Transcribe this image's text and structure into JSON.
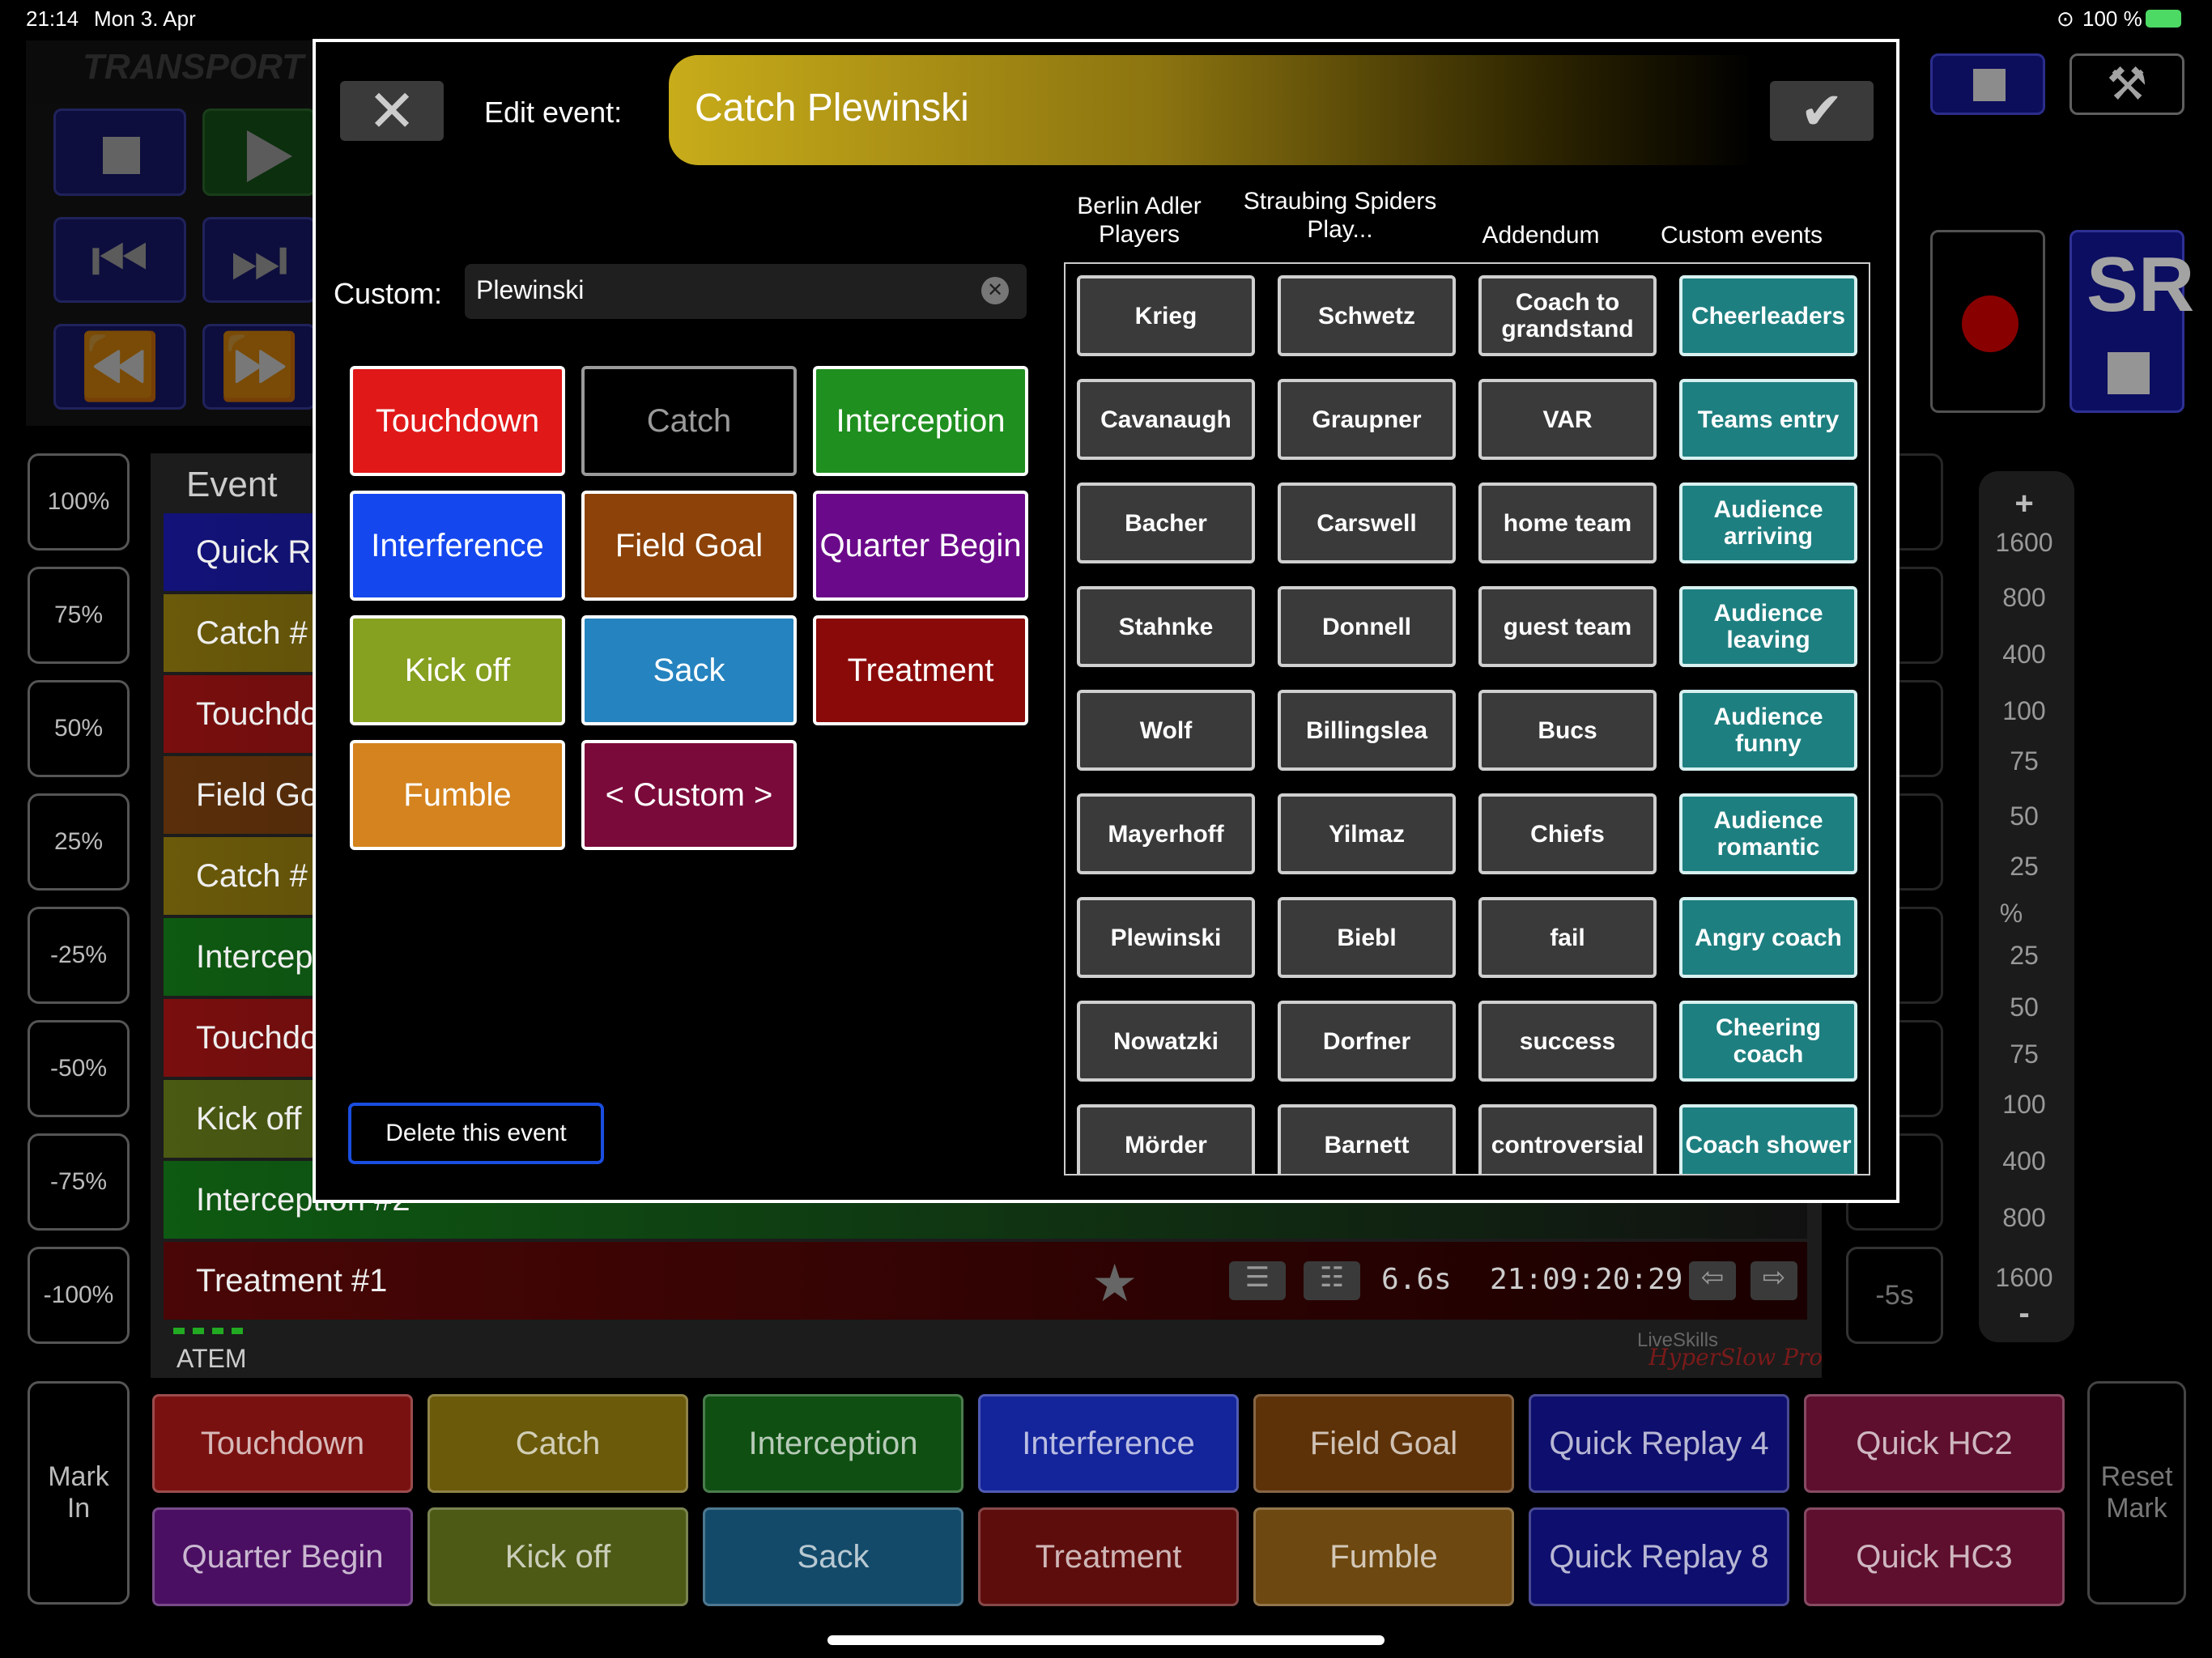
{
  "status": {
    "time": "21:14",
    "date": "Mon 3. Apr",
    "battery": "100 %"
  },
  "transport": {
    "label": "TRANSPORT"
  },
  "speed_buttons": [
    "100%",
    "75%",
    "50%",
    "25%",
    "-25%",
    "-50%",
    "-75%",
    "-100%"
  ],
  "right_buttons": [
    "-5s"
  ],
  "event_list": {
    "header": "Event",
    "rows": [
      {
        "name": "Quick R",
        "color": "#12127a"
      },
      {
        "name": "Catch #",
        "color": "#6b5a0a"
      },
      {
        "name": "Touchdo",
        "color": "#7a0e0e"
      },
      {
        "name": "Field Go",
        "color": "#5a2e0a"
      },
      {
        "name": "Catch #",
        "color": "#6b5a0a"
      },
      {
        "name": "Intercep",
        "color": "#0e5a12"
      },
      {
        "name": "Touchdo",
        "color": "#7a0e0e"
      },
      {
        "name": "Kick off",
        "color": "#4a5a12"
      },
      {
        "name": "Interception #2",
        "color": "#0e5a12"
      }
    ],
    "last_row": {
      "name": "Treatment #1",
      "duration": "6.6s",
      "timecode": "21:09:20:29",
      "color": "#4a0606"
    },
    "source": "ATEM",
    "brand_top": "LiveSkills",
    "brand_bottom": "HyperSlow Pro"
  },
  "scale": {
    "plus": "+",
    "minus": "-",
    "percent": "%",
    "top": [
      "1600",
      "800",
      "400",
      "100",
      "75",
      "50",
      "25"
    ],
    "bottom": [
      "25",
      "50",
      "75",
      "100",
      "400",
      "800",
      "1600"
    ]
  },
  "bottom_bar": {
    "mark_in": "Mark\nIn",
    "reset_mark": "Reset\nMark",
    "row1": [
      {
        "label": "Touchdown",
        "color": "#7a1111"
      },
      {
        "label": "Catch",
        "color": "#6a5a0a"
      },
      {
        "label": "Interception",
        "color": "#0f5012"
      },
      {
        "label": "Interference",
        "color": "#14249a"
      },
      {
        "label": "Field Goal",
        "color": "#5e3208"
      },
      {
        "label": "Quick Replay 4",
        "color": "#0e0e6e"
      },
      {
        "label": "Quick HC2",
        "color": "#5e0f2e"
      }
    ],
    "row2": [
      {
        "label": "Quarter Begin",
        "color": "#4a0f62"
      },
      {
        "label": "Kick off",
        "color": "#4d5a16"
      },
      {
        "label": "Sack",
        "color": "#134a6a"
      },
      {
        "label": "Treatment",
        "color": "#5e0d0d"
      },
      {
        "label": "Fumble",
        "color": "#6d4810"
      },
      {
        "label": "Quick Replay 8",
        "color": "#0e0e6e"
      },
      {
        "label": "Quick HC3",
        "color": "#5e0f2e"
      }
    ]
  },
  "modal": {
    "title_label": "Edit event:",
    "event_name": "Catch Plewinski",
    "custom_label": "Custom:",
    "custom_value": "Plewinski",
    "delete_label": "Delete this event",
    "event_types": [
      {
        "label": "Touchdown",
        "color": "#e01818"
      },
      {
        "label": "Catch",
        "color": "#000000",
        "text": "#9a9a9a"
      },
      {
        "label": "Interception",
        "color": "#1f8f1f"
      },
      {
        "label": "Interference",
        "color": "#1447ee"
      },
      {
        "label": "Field Goal",
        "color": "#8c4208"
      },
      {
        "label": "Quarter Begin",
        "color": "#6a0a8a"
      },
      {
        "label": "Kick off",
        "color": "#86a020"
      },
      {
        "label": "Sack",
        "color": "#2583bf"
      },
      {
        "label": "Treatment",
        "color": "#8a0a0a"
      },
      {
        "label": "Fumble",
        "color": "#d4831e"
      },
      {
        "label": "< Custom >",
        "color": "#7a0a3a"
      }
    ],
    "columns": [
      {
        "header": "Berlin Adler Players",
        "items": [
          "Krieg",
          "Cavanaugh",
          "Bacher",
          "Stahnke",
          "Wolf",
          "Mayerhoff",
          "Plewinski",
          "Nowatzki",
          "Mörder"
        ]
      },
      {
        "header": "Straubing Spiders Play...",
        "items": [
          "Schwetz",
          "Graupner",
          "Carswell",
          "Donnell",
          "Billingslea",
          "Yilmaz",
          "Biebl",
          "Dorfner",
          "Barnett"
        ]
      },
      {
        "header": "Addendum",
        "items": [
          "Coach to grandstand",
          "VAR",
          "home team",
          "guest team",
          "Bucs",
          "Chiefs",
          "fail",
          "success",
          "controversial"
        ]
      },
      {
        "header": "Custom events",
        "items": [
          "Cheerleaders",
          "Teams entry",
          "Audience arriving",
          "Audience leaving",
          "Audience funny",
          "Audience romantic",
          "Angry coach",
          "Cheering coach",
          "Coach shower"
        ]
      }
    ]
  }
}
